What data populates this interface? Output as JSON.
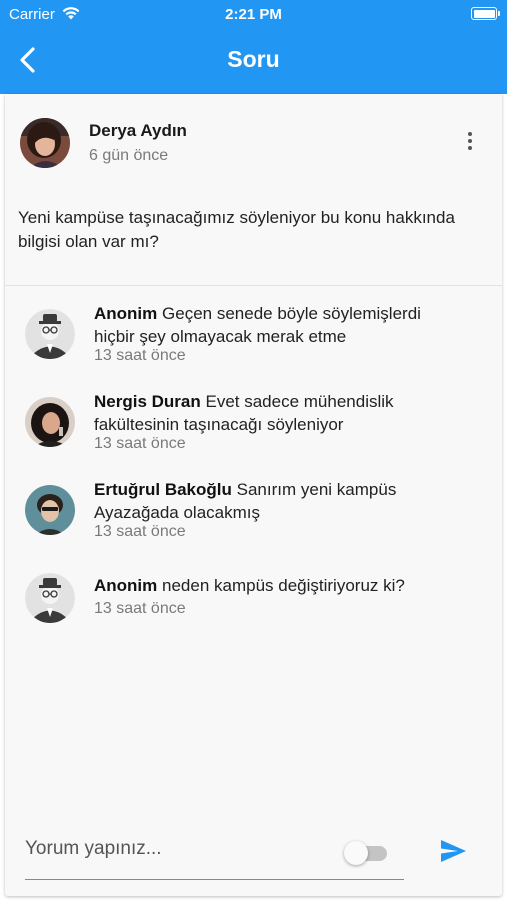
{
  "status_bar": {
    "carrier": "Carrier",
    "time": "2:21 PM"
  },
  "header": {
    "title": "Soru",
    "background_color": "#2196f3",
    "back_icon": "chevron-left-icon"
  },
  "post": {
    "author": "Derya Aydın",
    "time_ago": "6 gün önce",
    "text": "Yeni kampüse taşınacağımız söyleniyor bu konu hakkında bilgisi olan var mı?",
    "menu_icon": "more-vertical-icon"
  },
  "comments": [
    {
      "name": "Anonim",
      "text": "Geçen senede böyle söylemişlerdi hiçbir şey olmayacak merak etme",
      "time_ago": "13 saat önce",
      "avatar": "anonymous-avatar"
    },
    {
      "name": "Nergis Duran",
      "text": "Evet sadece mühendislik fakültesinin taşınacağı söyleniyor",
      "time_ago": "13 saat önce",
      "avatar": "user-photo"
    },
    {
      "name": "Ertuğrul  Bakoğlu",
      "text": "Sanırım yeni kampüs Ayazağada olacakmış",
      "time_ago": "13 saat önce",
      "avatar": "user-photo"
    },
    {
      "name": "Anonim",
      "text": "neden kampüs değiştiriyoruz ki?",
      "time_ago": "13 saat önce",
      "avatar": "anonymous-avatar"
    }
  ],
  "composer": {
    "placeholder": "Yorum yapınız...",
    "value": "",
    "anonymous_toggle_on": false,
    "send_icon": "send-icon",
    "send_color": "#2196f3"
  }
}
